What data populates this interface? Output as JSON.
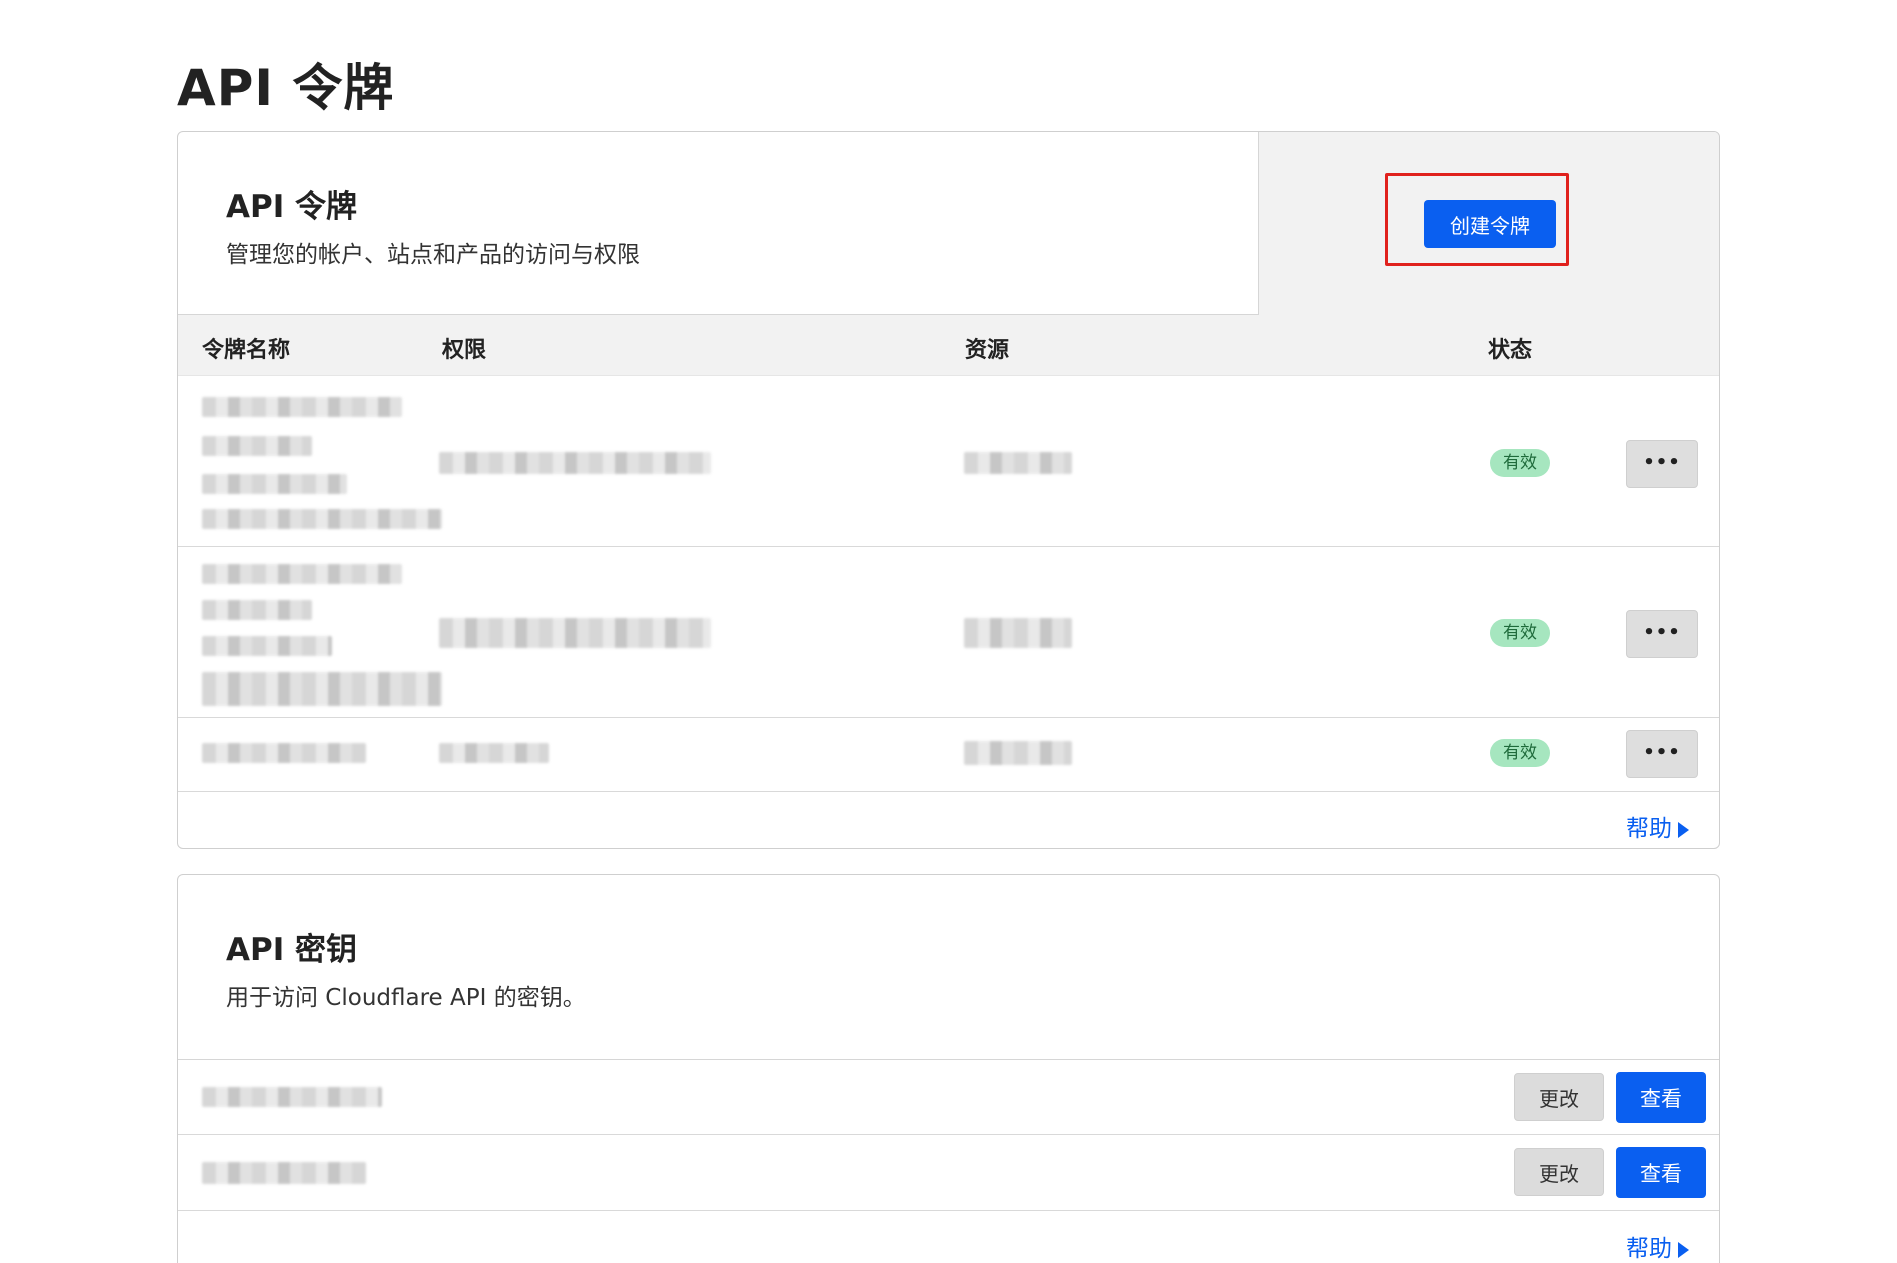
{
  "page": {
    "title": "API 令牌"
  },
  "tokens": {
    "title": "API 令牌",
    "description": "管理您的帐户、站点和产品的访问与权限",
    "create_button": "创建令牌",
    "columns": [
      "令牌名称",
      "权限",
      "资源",
      "状态"
    ],
    "rows": [
      {
        "status": "有效",
        "more": "•••"
      },
      {
        "status": "有效",
        "more": "•••"
      },
      {
        "status": "有效",
        "more": "•••"
      }
    ],
    "help": "帮助"
  },
  "keys": {
    "title": "API 密钥",
    "description": "用于访问 Cloudflare API 的密钥。",
    "rows": [
      {
        "change": "更改",
        "view": "查看"
      },
      {
        "change": "更改",
        "view": "查看"
      }
    ],
    "help": "帮助"
  },
  "colors": {
    "primary": "#0a5ff0",
    "active_badge": "#a6e6bf",
    "highlight": "#e0211d"
  }
}
